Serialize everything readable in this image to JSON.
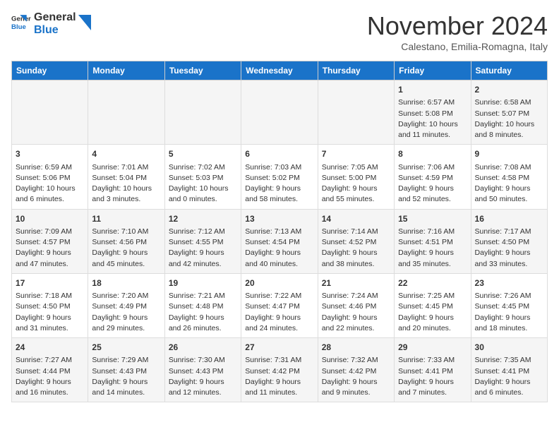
{
  "logo": {
    "line1": "General",
    "line2": "Blue"
  },
  "title": "November 2024",
  "subtitle": "Calestano, Emilia-Romagna, Italy",
  "headers": [
    "Sunday",
    "Monday",
    "Tuesday",
    "Wednesday",
    "Thursday",
    "Friday",
    "Saturday"
  ],
  "weeks": [
    [
      {
        "day": "",
        "info": ""
      },
      {
        "day": "",
        "info": ""
      },
      {
        "day": "",
        "info": ""
      },
      {
        "day": "",
        "info": ""
      },
      {
        "day": "",
        "info": ""
      },
      {
        "day": "1",
        "info": "Sunrise: 6:57 AM\nSunset: 5:08 PM\nDaylight: 10 hours and 11 minutes."
      },
      {
        "day": "2",
        "info": "Sunrise: 6:58 AM\nSunset: 5:07 PM\nDaylight: 10 hours and 8 minutes."
      }
    ],
    [
      {
        "day": "3",
        "info": "Sunrise: 6:59 AM\nSunset: 5:06 PM\nDaylight: 10 hours and 6 minutes."
      },
      {
        "day": "4",
        "info": "Sunrise: 7:01 AM\nSunset: 5:04 PM\nDaylight: 10 hours and 3 minutes."
      },
      {
        "day": "5",
        "info": "Sunrise: 7:02 AM\nSunset: 5:03 PM\nDaylight: 10 hours and 0 minutes."
      },
      {
        "day": "6",
        "info": "Sunrise: 7:03 AM\nSunset: 5:02 PM\nDaylight: 9 hours and 58 minutes."
      },
      {
        "day": "7",
        "info": "Sunrise: 7:05 AM\nSunset: 5:00 PM\nDaylight: 9 hours and 55 minutes."
      },
      {
        "day": "8",
        "info": "Sunrise: 7:06 AM\nSunset: 4:59 PM\nDaylight: 9 hours and 52 minutes."
      },
      {
        "day": "9",
        "info": "Sunrise: 7:08 AM\nSunset: 4:58 PM\nDaylight: 9 hours and 50 minutes."
      }
    ],
    [
      {
        "day": "10",
        "info": "Sunrise: 7:09 AM\nSunset: 4:57 PM\nDaylight: 9 hours and 47 minutes."
      },
      {
        "day": "11",
        "info": "Sunrise: 7:10 AM\nSunset: 4:56 PM\nDaylight: 9 hours and 45 minutes."
      },
      {
        "day": "12",
        "info": "Sunrise: 7:12 AM\nSunset: 4:55 PM\nDaylight: 9 hours and 42 minutes."
      },
      {
        "day": "13",
        "info": "Sunrise: 7:13 AM\nSunset: 4:54 PM\nDaylight: 9 hours and 40 minutes."
      },
      {
        "day": "14",
        "info": "Sunrise: 7:14 AM\nSunset: 4:52 PM\nDaylight: 9 hours and 38 minutes."
      },
      {
        "day": "15",
        "info": "Sunrise: 7:16 AM\nSunset: 4:51 PM\nDaylight: 9 hours and 35 minutes."
      },
      {
        "day": "16",
        "info": "Sunrise: 7:17 AM\nSunset: 4:50 PM\nDaylight: 9 hours and 33 minutes."
      }
    ],
    [
      {
        "day": "17",
        "info": "Sunrise: 7:18 AM\nSunset: 4:50 PM\nDaylight: 9 hours and 31 minutes."
      },
      {
        "day": "18",
        "info": "Sunrise: 7:20 AM\nSunset: 4:49 PM\nDaylight: 9 hours and 29 minutes."
      },
      {
        "day": "19",
        "info": "Sunrise: 7:21 AM\nSunset: 4:48 PM\nDaylight: 9 hours and 26 minutes."
      },
      {
        "day": "20",
        "info": "Sunrise: 7:22 AM\nSunset: 4:47 PM\nDaylight: 9 hours and 24 minutes."
      },
      {
        "day": "21",
        "info": "Sunrise: 7:24 AM\nSunset: 4:46 PM\nDaylight: 9 hours and 22 minutes."
      },
      {
        "day": "22",
        "info": "Sunrise: 7:25 AM\nSunset: 4:45 PM\nDaylight: 9 hours and 20 minutes."
      },
      {
        "day": "23",
        "info": "Sunrise: 7:26 AM\nSunset: 4:45 PM\nDaylight: 9 hours and 18 minutes."
      }
    ],
    [
      {
        "day": "24",
        "info": "Sunrise: 7:27 AM\nSunset: 4:44 PM\nDaylight: 9 hours and 16 minutes."
      },
      {
        "day": "25",
        "info": "Sunrise: 7:29 AM\nSunset: 4:43 PM\nDaylight: 9 hours and 14 minutes."
      },
      {
        "day": "26",
        "info": "Sunrise: 7:30 AM\nSunset: 4:43 PM\nDaylight: 9 hours and 12 minutes."
      },
      {
        "day": "27",
        "info": "Sunrise: 7:31 AM\nSunset: 4:42 PM\nDaylight: 9 hours and 11 minutes."
      },
      {
        "day": "28",
        "info": "Sunrise: 7:32 AM\nSunset: 4:42 PM\nDaylight: 9 hours and 9 minutes."
      },
      {
        "day": "29",
        "info": "Sunrise: 7:33 AM\nSunset: 4:41 PM\nDaylight: 9 hours and 7 minutes."
      },
      {
        "day": "30",
        "info": "Sunrise: 7:35 AM\nSunset: 4:41 PM\nDaylight: 9 hours and 6 minutes."
      }
    ]
  ]
}
